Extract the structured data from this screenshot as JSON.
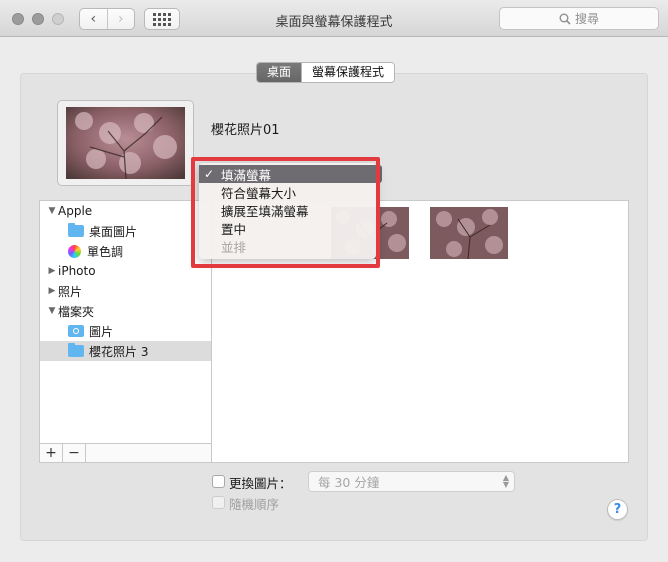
{
  "window": {
    "title": "桌面與螢幕保護程式"
  },
  "toolbar": {
    "back_icon": "chevron-left-icon",
    "forward_icon": "chevron-right-icon",
    "grid_icon": "show-all-grid-icon",
    "back_glyph": "‹",
    "forward_glyph": "›",
    "search_placeholder": "搜尋"
  },
  "tabs": [
    {
      "label": "桌面",
      "selected": true
    },
    {
      "label": "螢幕保護程式",
      "selected": false
    }
  ],
  "current_wallpaper": {
    "name": "櫻花照片01"
  },
  "sources": [
    {
      "label": "Apple",
      "type": "group",
      "expanded": true
    },
    {
      "label": "桌面圖片",
      "type": "folder"
    },
    {
      "label": "單色調",
      "type": "colors"
    },
    {
      "label": "iPhoto",
      "type": "group",
      "expanded": false
    },
    {
      "label": "照片",
      "type": "group",
      "expanded": false
    },
    {
      "label": "檔案夾",
      "type": "group",
      "expanded": true
    },
    {
      "label": "圖片",
      "type": "camera-folder"
    },
    {
      "label": "櫻花照片 3",
      "type": "folder",
      "selected": true
    }
  ],
  "source_controls": {
    "add": "+",
    "remove": "−"
  },
  "fit_menu": {
    "items": [
      {
        "label": "填滿螢幕",
        "checked": true,
        "enabled": true
      },
      {
        "label": "符合螢幕大小",
        "checked": false,
        "enabled": true
      },
      {
        "label": "擴展至填滿螢幕",
        "checked": false,
        "enabled": true
      },
      {
        "label": "置中",
        "checked": false,
        "enabled": true
      },
      {
        "label": "並排",
        "checked": false,
        "enabled": false
      }
    ],
    "check_glyph": "✓"
  },
  "options": {
    "change_picture_label": "更換圖片：",
    "change_picture_checked": false,
    "interval_value": "每 30 分鐘",
    "random_order_label": "隨機順序",
    "random_order_enabled": false
  },
  "help_label": "?",
  "colors": {
    "highlight_border": "#e23a3f",
    "menu_selection": "#6e6c70",
    "folder_blue": "#62b6ef"
  }
}
